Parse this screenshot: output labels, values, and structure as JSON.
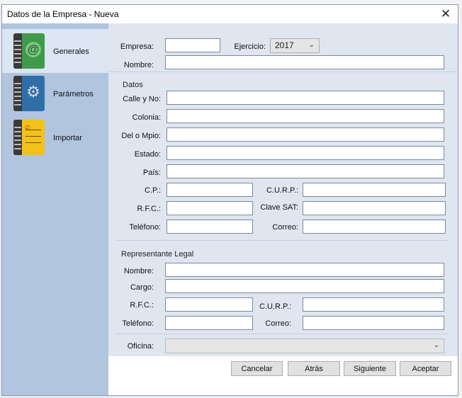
{
  "window": {
    "title": "Datos de la Empresa - Nueva"
  },
  "sidebar": {
    "items": [
      {
        "label": "Generales",
        "icon": "contact-book-icon",
        "active": true
      },
      {
        "label": "Parámetros",
        "icon": "gear-book-icon",
        "active": false
      },
      {
        "label": "Importar",
        "icon": "checklist-book-icon",
        "active": false
      }
    ]
  },
  "form": {
    "empresa_label": "Empresa:",
    "empresa_value": "",
    "ejercicio_label": "Ejercicio:",
    "ejercicio_value": "2017",
    "nombre_label": "Nombre:",
    "nombre_value": "",
    "datos": {
      "title": "Datos",
      "calle_label": "Calle y No:",
      "colonia_label": "Colonia:",
      "del_label": "Del o Mpio:",
      "estado_label": "Estado:",
      "pais_label": "País:",
      "cp_label": "C.P.:",
      "curp_label": "C.U.R.P.:",
      "rfc_label": "R.F.C.:",
      "clave_label": "Clave SAT:",
      "telefono_label": "Teléfono:",
      "correo_label": "Correo:"
    },
    "representante": {
      "title": "Representante Legal",
      "nombre_label": "Nombre:",
      "cargo_label": "Cargo:",
      "rfc_label": "R.F.C.:",
      "curp_label": "C.U.R.P.:",
      "telefono_label": "Teléfono:",
      "correo_label": "Correo:"
    },
    "oficina_label": "Oficina:",
    "oficina_value": ""
  },
  "buttons": {
    "cancelar": "Cancelar",
    "atras": "Atrás",
    "siguiente": "Siguiente",
    "aceptar": "Aceptar"
  },
  "colors": {
    "sidebar_bg": "#b1c5df",
    "active_item_bg": "#dce5f2",
    "book_green": "#3f9a4a",
    "book_blue": "#2f6fa8",
    "book_yellow": "#f2c21a"
  }
}
